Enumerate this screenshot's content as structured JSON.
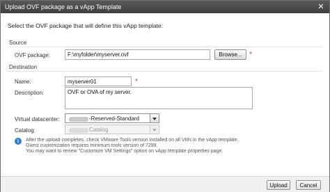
{
  "window": {
    "title": "Upload OVF package as a vApp Template"
  },
  "instruction": "Select the OVF package that will define this vApp template:",
  "source": {
    "heading": "Source",
    "ovf_label": "OVF package:",
    "ovf_value": "F:\\myfolder\\myserver.ovf",
    "browse_label": "Browse..."
  },
  "destination": {
    "heading": "Destination",
    "name_label": "Name:",
    "name_value": "myserver01",
    "description_label": "Description:",
    "description_value": "OVF or OVA of my server.",
    "vdc_label": "Virtual datacenter:",
    "vdc_value": "-Reserved-Standard",
    "catalog_label": "Catalog:",
    "catalog_value": "Catalog"
  },
  "required_marker": "*",
  "info": {
    "icon": "info-icon",
    "lines": [
      "After the upload completes, check VMware Tools version installed on all VMs in the vApp template.",
      "Guest customization requires minimum tools version of 7299.",
      "You may want to review \"Customize VM Settings\" option on vApp template properties page."
    ]
  },
  "footer": {
    "upload_label": "Upload",
    "cancel_label": "Cancel"
  },
  "colors": {
    "titlebar": "#4a4a4a",
    "required": "#e03a3a",
    "info": "#2f7fd0"
  }
}
